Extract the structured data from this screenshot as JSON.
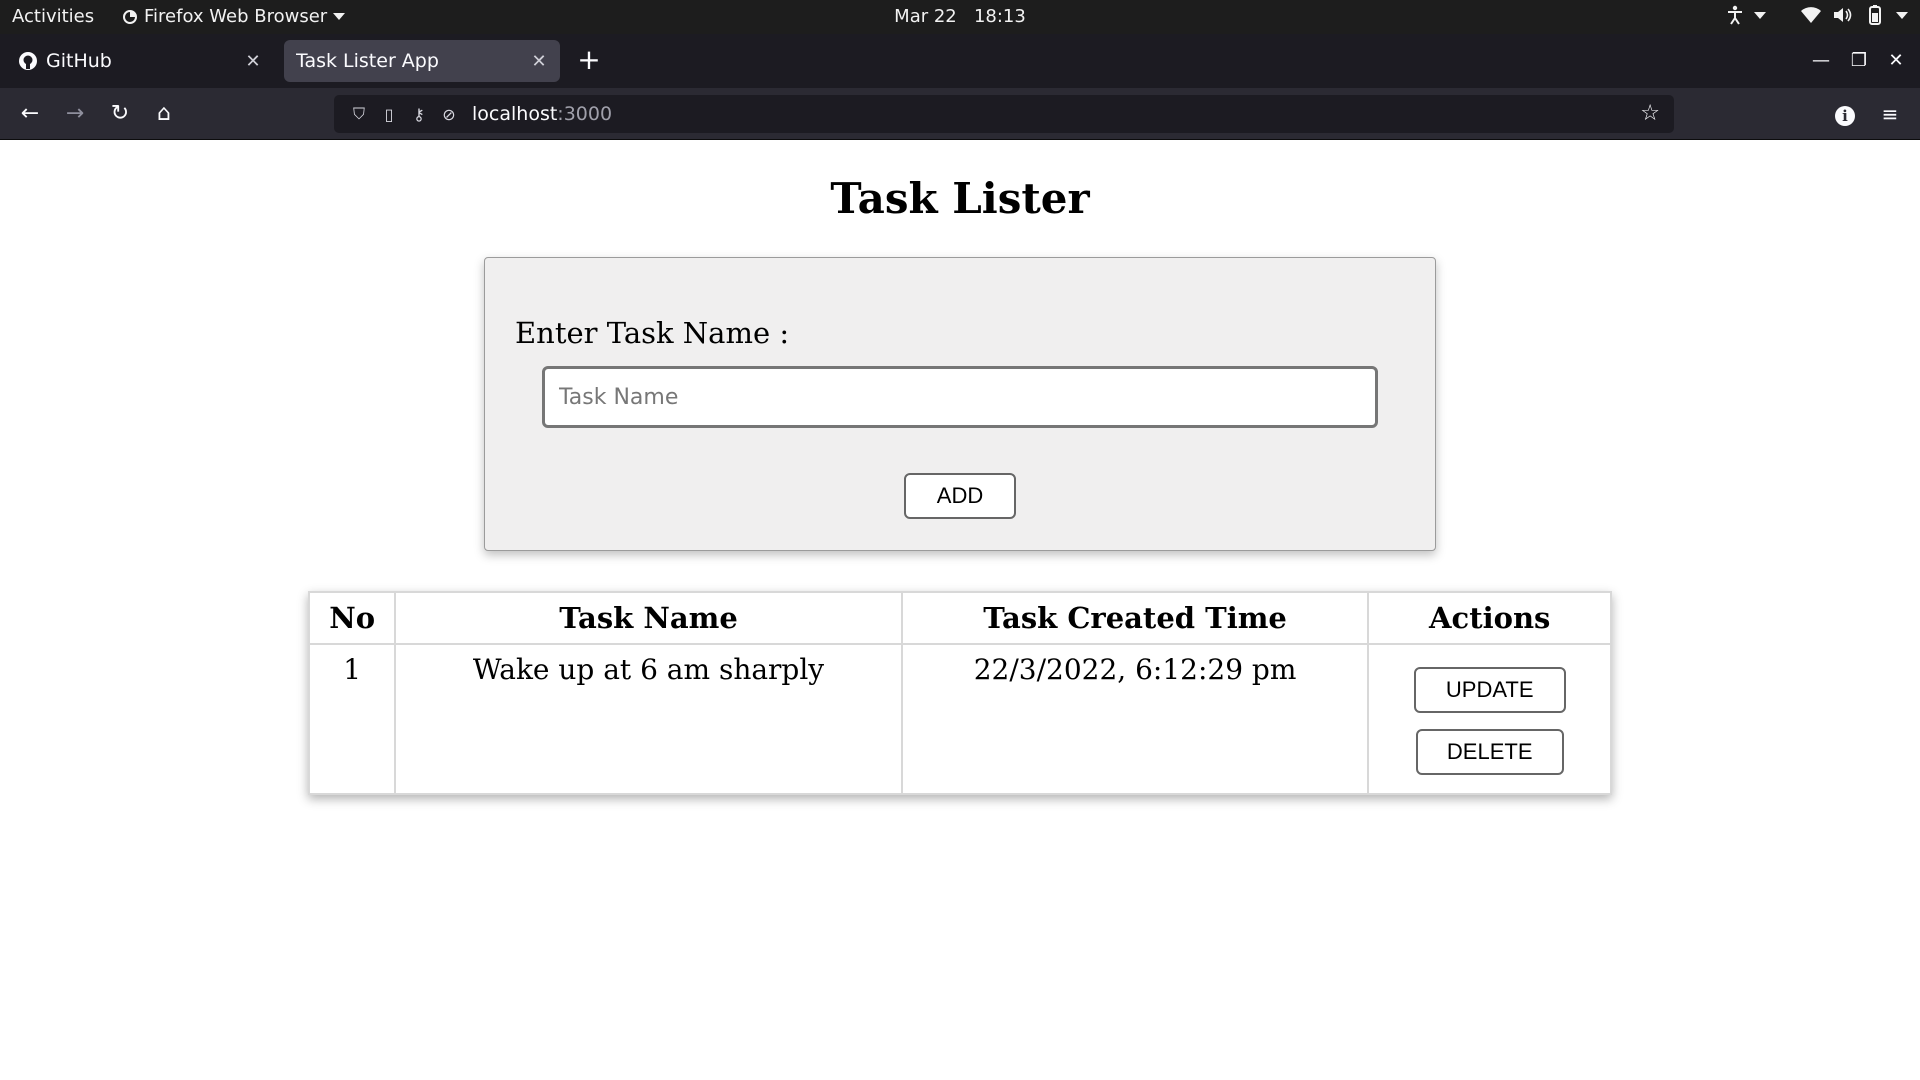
{
  "system_bar": {
    "activities": "Activities",
    "app_name": "Firefox Web Browser",
    "date": "Mar 22",
    "time": "18:13"
  },
  "browser": {
    "tabs": [
      {
        "title": "GitHub",
        "icon": "github-icon",
        "active": false
      },
      {
        "title": "Task Lister App",
        "icon": "",
        "active": true
      }
    ],
    "url_host": "localhost",
    "url_port": ":3000"
  },
  "page": {
    "title": "Task Lister",
    "form": {
      "label": "Enter Task Name :",
      "input_placeholder": "Task Name",
      "input_value": "",
      "add_label": "ADD"
    },
    "table": {
      "headers": [
        "No",
        "Task Name",
        "Task Created Time",
        "Actions"
      ],
      "rows": [
        {
          "no": "1",
          "task_name": "Wake up at 6 am sharply",
          "created_time": "22/3/2022, 6:12:29 pm",
          "update_label": "UPDATE",
          "delete_label": "DELETE"
        }
      ]
    }
  }
}
